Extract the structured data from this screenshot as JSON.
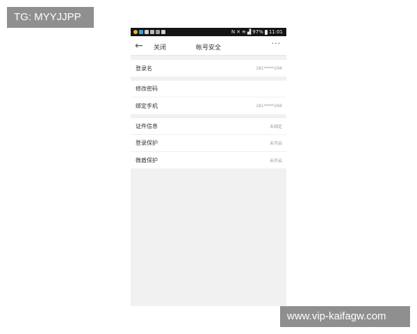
{
  "watermarks": {
    "top": "TG: MYYJJPP",
    "bottom": "www.vip-kaifagw.com"
  },
  "statusbar": {
    "battery": "97%",
    "time": "11:01",
    "left_icons": [
      "app-icon-1",
      "app-icon-2",
      "app-icon-3",
      "app-icon-4",
      "app-icon-5",
      "app-icon-6"
    ],
    "right_icons": [
      "nfc-icon",
      "mute-icon",
      "wifi-icon",
      "signal-icon",
      "battery-icon"
    ]
  },
  "topbar": {
    "back_icon": "back-arrow-icon",
    "close_label": "关闭",
    "title": "帐号安全",
    "more_icon": "more-icon"
  },
  "groups": [
    [
      {
        "label": "登录名",
        "value": "181*****294"
      }
    ],
    [
      {
        "label": "修改密码",
        "value": ""
      },
      {
        "label": "绑定手机",
        "value": "181*****294"
      }
    ],
    [
      {
        "label": "证件信息",
        "value": "未绑定"
      },
      {
        "label": "登录保护",
        "value": "未开启"
      },
      {
        "label": "微盾保护",
        "value": "未开启"
      }
    ]
  ],
  "colors": {
    "statusbar_bg": "#141414",
    "screen_bg": "#f1f1f1",
    "row_bg": "#ffffff",
    "watermark_bg": "#8f8f8f"
  }
}
